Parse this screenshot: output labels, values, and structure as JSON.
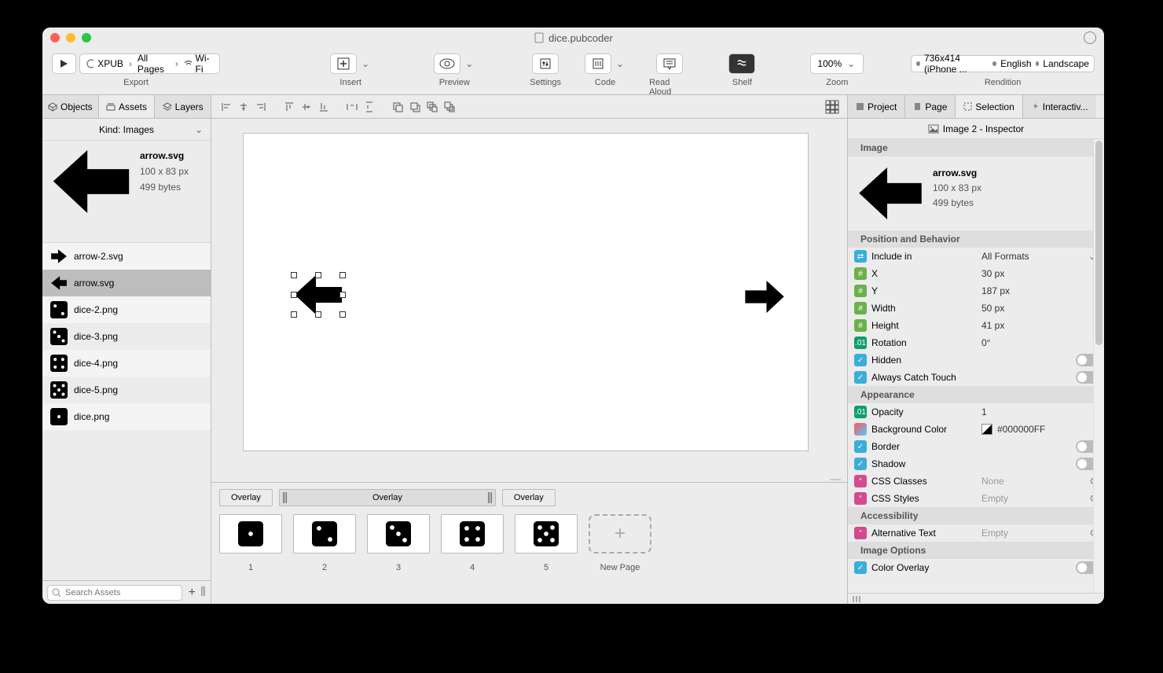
{
  "window": {
    "title": "dice.pubcoder"
  },
  "toolbar": {
    "export": {
      "label": "Export",
      "play": "▶",
      "xpub": "XPUB",
      "allPages": "All Pages",
      "wifi": "Wi-Fi"
    },
    "insert": {
      "label": "Insert"
    },
    "preview": {
      "label": "Preview"
    },
    "settings": {
      "label": "Settings"
    },
    "code": {
      "label": "Code"
    },
    "readAloud": {
      "label": "Read Aloud"
    },
    "shelf": {
      "label": "Shelf"
    },
    "zoom": {
      "label": "Zoom",
      "value": "100%"
    },
    "rendition": {
      "label": "Rendition",
      "device": "736x414 (iPhone ...",
      "lang": "English",
      "orient": "Landscape"
    }
  },
  "leftTabs": {
    "objects": "Objects",
    "assets": "Assets",
    "layers": "Layers"
  },
  "kind": "Kind: Images",
  "preview": {
    "name": "arrow.svg",
    "dims": "100 x 83 px",
    "size": "499 bytes"
  },
  "assets": [
    {
      "name": "arrow-2.svg",
      "icon": "arrow-right"
    },
    {
      "name": "arrow.svg",
      "icon": "arrow-left",
      "selected": true
    },
    {
      "name": "dice-2.png",
      "icon": "dice",
      "pips": 2
    },
    {
      "name": "dice-3.png",
      "icon": "dice",
      "pips": 3
    },
    {
      "name": "dice-4.png",
      "icon": "dice",
      "pips": 4
    },
    {
      "name": "dice-5.png",
      "icon": "dice",
      "pips": 5
    },
    {
      "name": "dice.png",
      "icon": "dice",
      "pips": 1
    }
  ],
  "search": {
    "placeholder": "Search Assets"
  },
  "overlays": [
    "Overlay",
    "Overlay",
    "Overlay"
  ],
  "pages": [
    {
      "label": "1",
      "pips": 1
    },
    {
      "label": "2",
      "pips": 2
    },
    {
      "label": "3",
      "pips": 3
    },
    {
      "label": "4",
      "pips": 4
    },
    {
      "label": "5",
      "pips": 5
    }
  ],
  "newPage": "New Page",
  "rightTabs": {
    "project": "Project",
    "page": "Page",
    "selection": "Selection",
    "interactivity": "Interactiv..."
  },
  "inspector": {
    "title": "Image 2 - Inspector",
    "imageHead": "Image",
    "img": {
      "name": "arrow.svg",
      "dims": "100 x 83 px",
      "size": "499 bytes"
    },
    "sections": {
      "posBehav": "Position and Behavior",
      "appearance": "Appearance",
      "accessibility": "Accessibility",
      "imageOptions": "Image Options"
    },
    "props": {
      "includeIn": {
        "label": "Include in",
        "value": "All Formats"
      },
      "x": {
        "label": "X",
        "value": "30 px"
      },
      "y": {
        "label": "Y",
        "value": "187 px"
      },
      "width": {
        "label": "Width",
        "value": "50 px"
      },
      "height": {
        "label": "Height",
        "value": "41 px"
      },
      "rotation": {
        "label": "Rotation",
        "value": "0°"
      },
      "hidden": {
        "label": "Hidden"
      },
      "catchTouch": {
        "label": "Always Catch Touch"
      },
      "opacity": {
        "label": "Opacity",
        "value": "1"
      },
      "bgColor": {
        "label": "Background Color",
        "value": "#000000FF"
      },
      "border": {
        "label": "Border"
      },
      "shadow": {
        "label": "Shadow"
      },
      "cssClasses": {
        "label": "CSS Classes",
        "value": "None"
      },
      "cssStyles": {
        "label": "CSS Styles",
        "value": "Empty"
      },
      "altText": {
        "label": "Alternative Text",
        "value": "Empty"
      },
      "colorOverlay": {
        "label": "Color Overlay"
      }
    }
  }
}
